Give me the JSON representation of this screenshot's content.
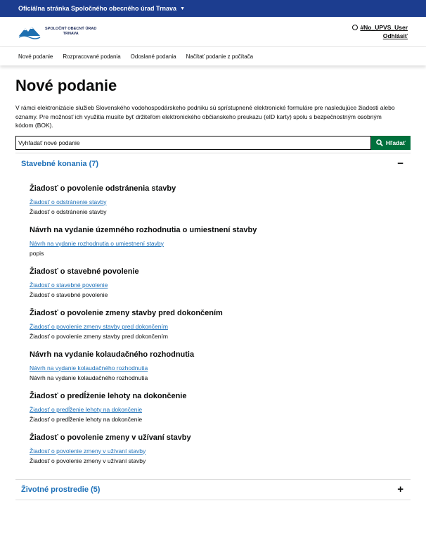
{
  "topbar": {
    "label": "Oficiálna stránka Spoločného obecného úrad Trnava"
  },
  "header": {
    "logo_line1": "Spoločný obecný úrad",
    "logo_line2": "Trnava",
    "user_name": "#No_UPVS_User",
    "logout": "Odhlásiť"
  },
  "nav": [
    {
      "label": "Nové podanie"
    },
    {
      "label": "Rozpracované podania"
    },
    {
      "label": "Odoslané podania"
    },
    {
      "label": "Načítať podanie z počítača"
    }
  ],
  "page": {
    "title": "Nové podanie",
    "intro": "V rámci elektronizácie služieb Slovenského vodohospodárskeho podniku sú sprístupnené elektronické formuláre pre nasledujúce žiadosti alebo oznamy. Pre možnosť ich využitia musíte byť držiteľom elektronického občianskeho preukazu (eID karty) spolu s bezpečnostným osobným kódom (BOK)."
  },
  "search": {
    "placeholder": "Vyhľadať nové podanie",
    "button": "Hľadať"
  },
  "sections": [
    {
      "title": "Stavebné konania (7)",
      "toggle": "−",
      "items": [
        {
          "heading": "Žiadosť o povolenie odstránenia stavby",
          "link": "Žiadosť o odstránenie stavby",
          "desc": "Žiadosť o odstránenie stavby"
        },
        {
          "heading": "Návrh na vydanie územného rozhodnutia o umiestnení stavby",
          "link": "Návrh na vydanie rozhodnutia o umiestnení stavby",
          "desc": "popis"
        },
        {
          "heading": "Žiadosť o stavebné povolenie",
          "link": "Žiadosť o stavebné povolenie",
          "desc": "Žiadosť o stavebné povolenie"
        },
        {
          "heading": "Žiadosť o povolenie zmeny stavby pred dokončením",
          "link": "Žiadosť o povolenie zmeny stavby pred dokončením",
          "desc": "Žiadosť o povolenie zmeny stavby pred dokončením"
        },
        {
          "heading": "Návrh na vydanie kolaudačného rozhodnutia",
          "link": "Návrh na vydanie kolaudačného rozhodnutia",
          "desc": "Návrh na vydanie kolaudačného rozhodnutia"
        },
        {
          "heading": "Žiadosť o predĺženie lehoty na dokončenie",
          "link": "Žiadosť o predĺženie lehoty na dokončenie",
          "desc": "Žiadosť o predĺženie lehoty na dokončenie"
        },
        {
          "heading": "Žiadosť o povolenie zmeny v užívaní stavby",
          "link": "Žiadosť o povolenie zmeny v užívaní stavby",
          "desc": "Žiadosť o povolenie zmeny v užívaní stavby"
        }
      ]
    },
    {
      "title": "Životné prostredie (5)",
      "toggle": "+"
    }
  ],
  "colors": {
    "topbar": "#1c3d8f",
    "link": "#1d70b8",
    "button": "#00703c"
  }
}
